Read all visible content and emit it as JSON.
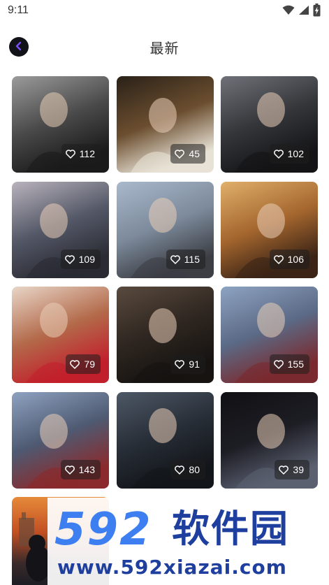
{
  "status_bar": {
    "time": "9:11",
    "icons": [
      "wifi-icon",
      "signal-icon",
      "battery-charging-icon"
    ]
  },
  "header": {
    "title": "最新",
    "back_icon": "chevron-left-icon",
    "back_color": "#121219",
    "back_arrow_color": "#7b4dff"
  },
  "wallpapers": [
    {
      "likes": "112",
      "palette": [
        "#9b9b9b",
        "#4a4a4a",
        "#1a1a1a"
      ]
    },
    {
      "likes": "45",
      "palette": [
        "#2a2118",
        "#6b4e2f",
        "#e8e2d6"
      ]
    },
    {
      "likes": "102",
      "palette": [
        "#6f7278",
        "#34363a",
        "#141416"
      ]
    },
    {
      "likes": "109",
      "palette": [
        "#b9b3bd",
        "#545867",
        "#2a2b33"
      ]
    },
    {
      "likes": "115",
      "palette": [
        "#a9b9cc",
        "#7c8a9b",
        "#3c3e44"
      ]
    },
    {
      "likes": "106",
      "palette": [
        "#e0b06a",
        "#a4662e",
        "#3b2416"
      ]
    },
    {
      "likes": "79",
      "palette": [
        "#e8d6c8",
        "#b36a4a",
        "#c21f2c"
      ]
    },
    {
      "likes": "91",
      "palette": [
        "#5a4a3e",
        "#2e2620",
        "#161311"
      ]
    },
    {
      "likes": "155",
      "palette": [
        "#8ea3c2",
        "#5b6a86",
        "#7a2a2e"
      ]
    },
    {
      "likes": "143",
      "palette": [
        "#8ea2c0",
        "#4e5a72",
        "#8a2a2c"
      ]
    },
    {
      "likes": "80",
      "palette": [
        "#4d5866",
        "#272d36",
        "#121519"
      ]
    },
    {
      "likes": "39",
      "palette": [
        "#101014",
        "#1d1d24",
        "#5a6070"
      ]
    }
  ],
  "watermark": {
    "logo": "592",
    "text": "软件园",
    "url": "www.592xiazai.com"
  }
}
